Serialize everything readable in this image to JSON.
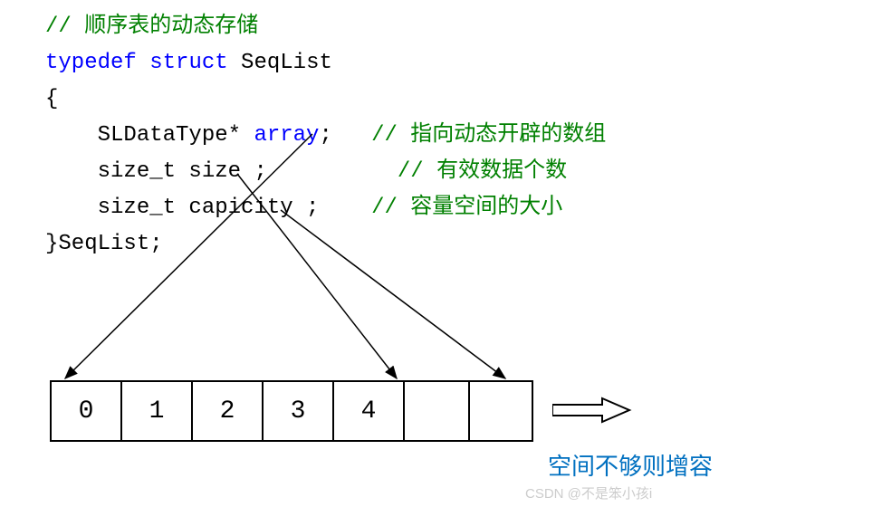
{
  "code": {
    "comment_header": "// 顺序表的动态存储",
    "kw_typedef": "typedef",
    "kw_struct": "struct",
    "struct_name": " SeqList",
    "brace_open": "{",
    "line1_type": "    SLDataType* ",
    "line1_name": "array",
    "line1_semi": ";",
    "line1_comment": "// 指向动态开辟的数组",
    "line2_code": "    size_t size ;",
    "line2_comment": "// 有效数据个数",
    "line3_code": "    size_t capicity ;",
    "line3_comment": "// 容量空间的大小",
    "brace_close": "}SeqList;"
  },
  "array_cells": {
    "c0": "0",
    "c1": "1",
    "c2": "2",
    "c3": "3",
    "c4": "4",
    "c5": "",
    "c6": ""
  },
  "bottom_label": "空间不够则增容",
  "watermark": "CSDN @不是笨小孩i"
}
